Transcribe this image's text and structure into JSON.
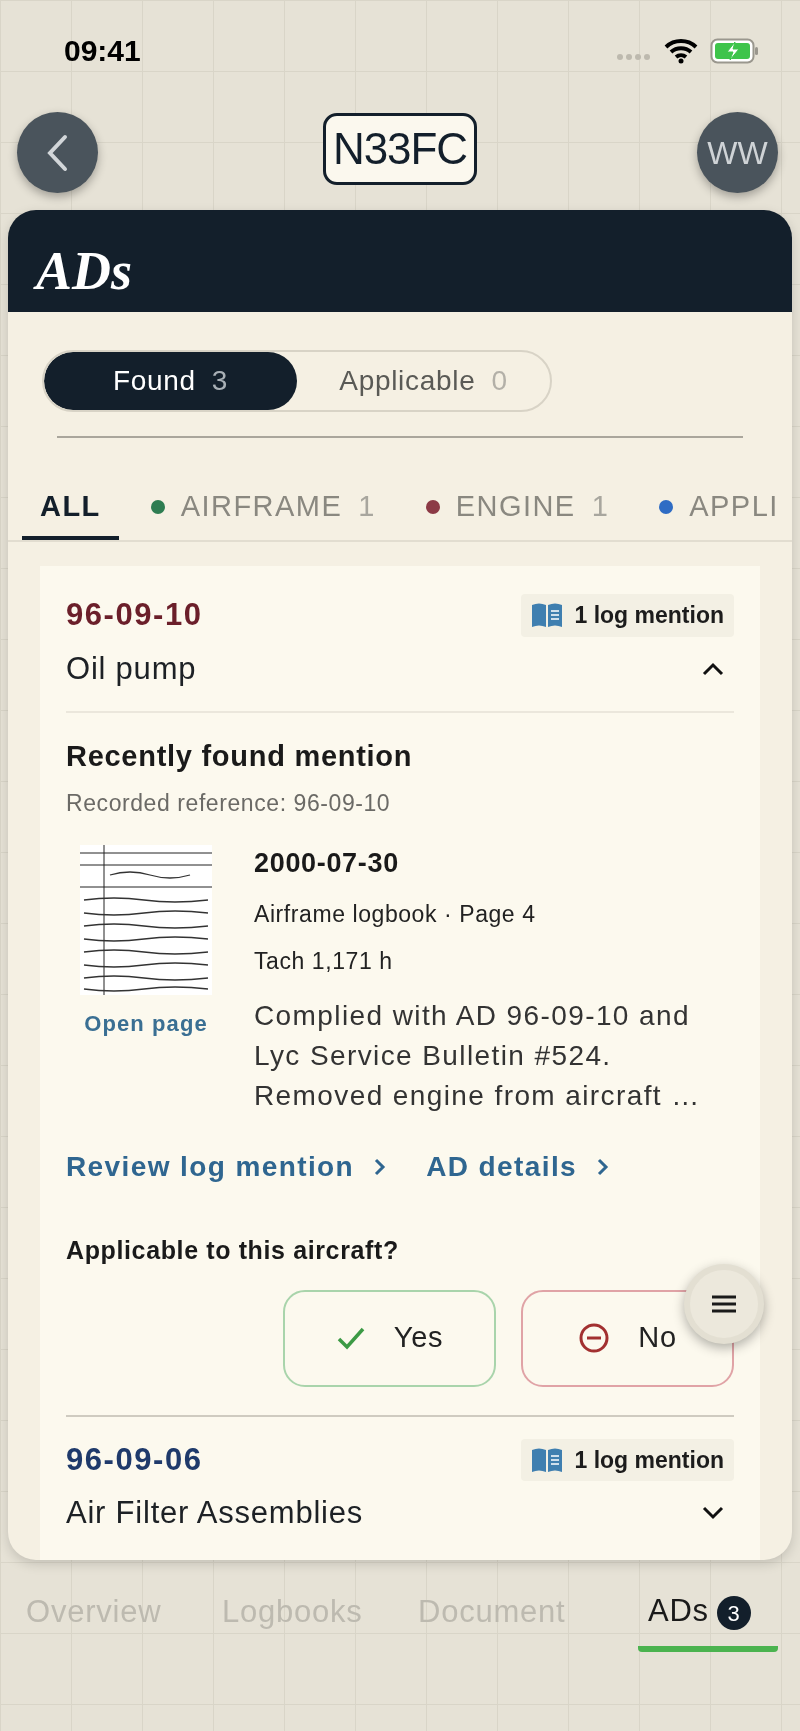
{
  "status_bar": {
    "time": "09:41"
  },
  "nav": {
    "aircraft": "N33FC",
    "avatar_initials": "WW"
  },
  "sheet": {
    "title": "ADs"
  },
  "segments": [
    {
      "label": "Found",
      "count": "3",
      "selected": true
    },
    {
      "label": "Applicable",
      "count": "0",
      "selected": false
    }
  ],
  "categories": [
    {
      "label": "ALL",
      "selected": true
    },
    {
      "label": "AIRFRAME",
      "count": "1",
      "color": "#2e7d52",
      "selected": false
    },
    {
      "label": "ENGINE",
      "count": "1",
      "color": "#8c3a46",
      "selected": false
    },
    {
      "label": "APPLI",
      "color": "#2f6cc4",
      "selected": false
    }
  ],
  "ads": [
    {
      "number": "96-09-10",
      "color": "#6b1f2a",
      "mentions": "1 log mention",
      "title": "Oil pump",
      "expanded": true,
      "detail": {
        "heading": "Recently found mention",
        "reference": "Recorded reference: 96-09-10",
        "open_page": "Open page",
        "date": "2000-07-30",
        "source": "Airframe logbook · Page 4",
        "tach": "Tach 1,171 h",
        "note": "Complied with AD 96-09-10 and Lyc Service Bulletin #524. Removed engine from aircraft …",
        "links": [
          "Review log mention",
          "AD details"
        ],
        "question": "Applicable to this aircraft?",
        "answers": [
          {
            "kind": "yes",
            "label": "Yes"
          },
          {
            "kind": "no",
            "label": "No"
          }
        ]
      }
    },
    {
      "number": "96-09-06",
      "color": "#1f3a6b",
      "mentions": "1 log mention",
      "title": "Air Filter Assemblies",
      "expanded": false
    }
  ],
  "bottom_tabs": [
    {
      "label": "Overview",
      "selected": false
    },
    {
      "label": "Logbooks",
      "selected": false
    },
    {
      "label": "Document",
      "selected": false
    },
    {
      "label": "ADs",
      "badge": "3",
      "selected": true
    }
  ]
}
